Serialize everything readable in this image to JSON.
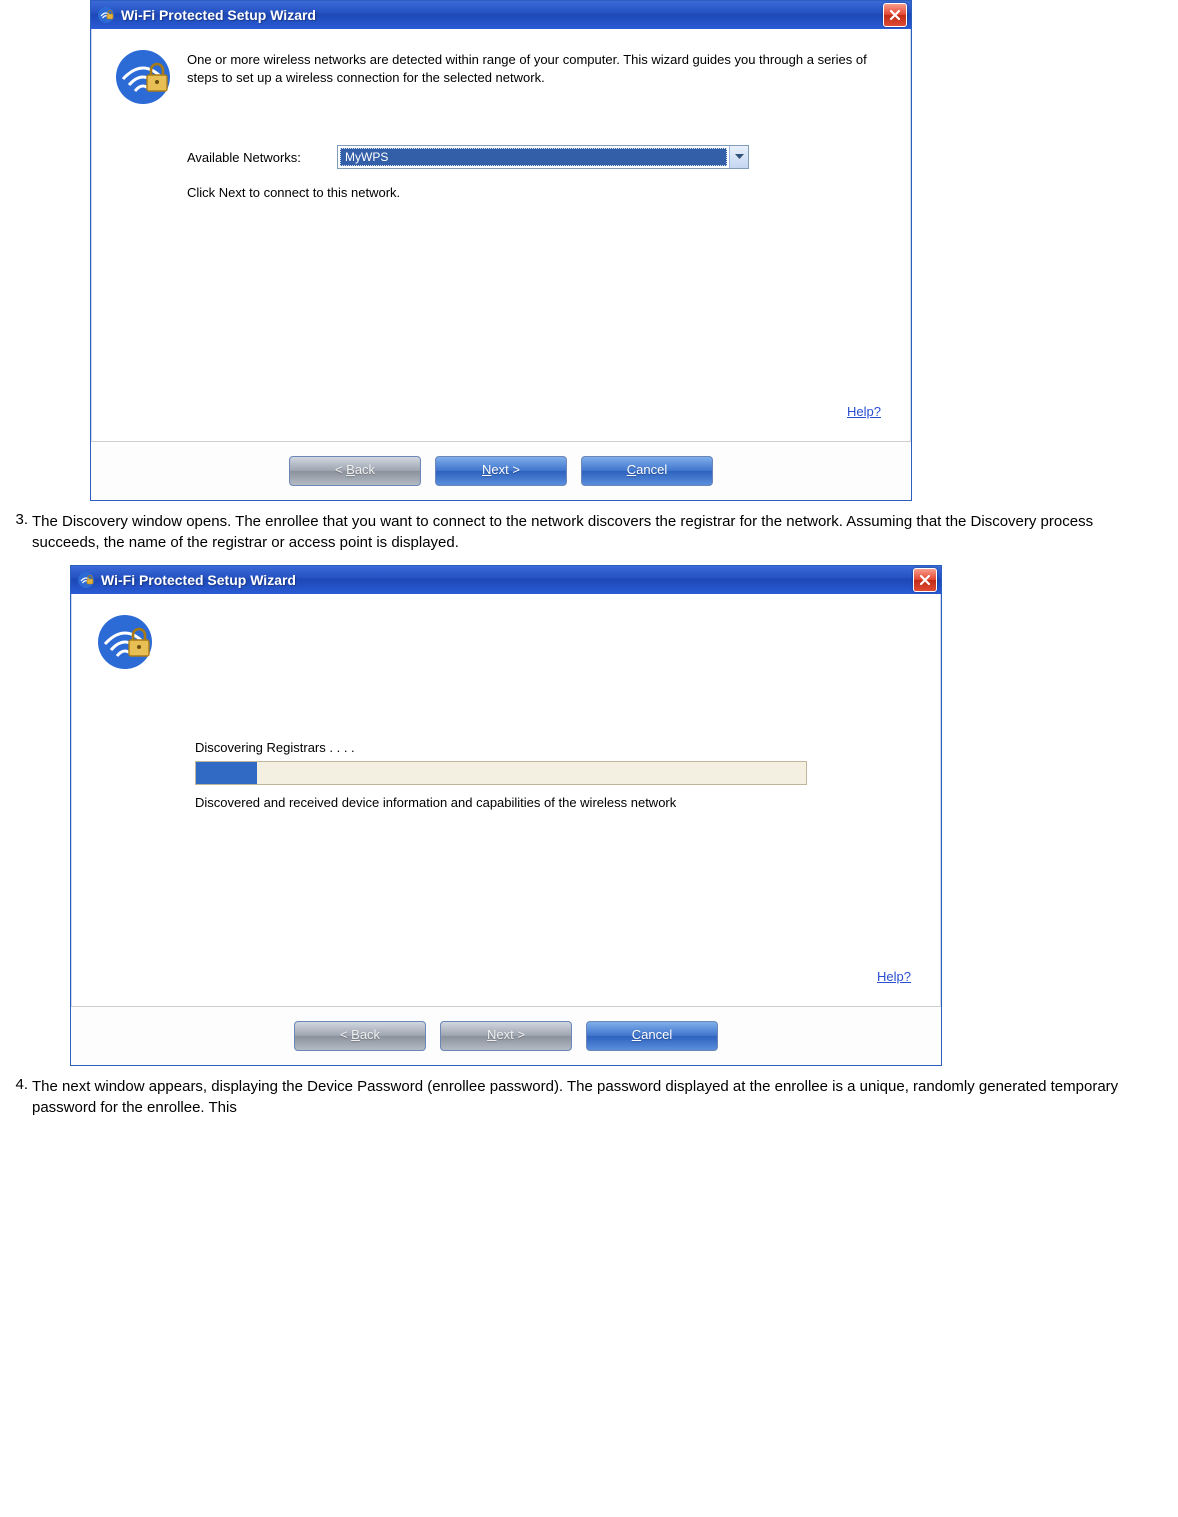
{
  "dialog1": {
    "title": "Wi-Fi Protected Setup Wizard",
    "intro": "One or more wireless networks are detected within range of your computer. This wizard guides you through a series of steps to set up a wireless connection for the selected network.",
    "networks_label": "Available Networks:",
    "selected_network": "MyWPS",
    "instruction": "Click Next to connect to this network.",
    "help_label": "Help?",
    "buttons": {
      "back": "< Back",
      "next": "Next >",
      "cancel": "Cancel"
    }
  },
  "step3": {
    "number": "3.",
    "text": "The Discovery window opens. The enrollee that you want to connect to the network discovers the registrar for the network. Assuming that the Discovery process succeeds, the name of the registrar or access point is displayed."
  },
  "dialog2": {
    "title": "Wi-Fi Protected Setup Wizard",
    "discovering_label": "Discovering Registrars . . . .",
    "progress_percent": 10,
    "status_text": "Discovered and received device information and capabilities of the wireless network",
    "help_label": "Help?",
    "buttons": {
      "back": "< Back",
      "next": "Next >",
      "cancel": "Cancel"
    }
  },
  "step4": {
    "number": "4.",
    "text": "The next window appears, displaying the Device Password (enrollee password). The password displayed at the enrollee is a unique, randomly generated temporary password for the enrollee. This"
  }
}
